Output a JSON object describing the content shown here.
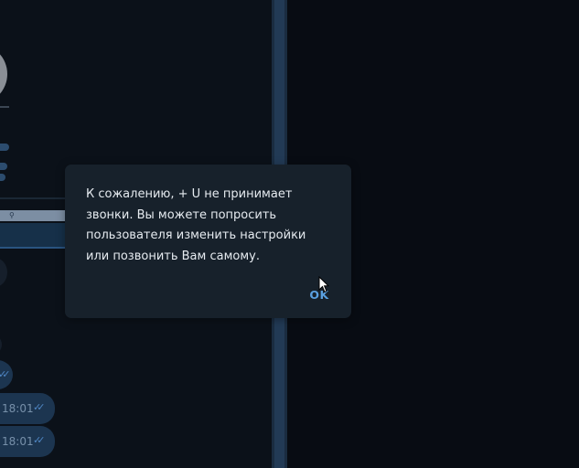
{
  "dialog": {
    "message": "К сожалению, + U не принимает\nзвонки. Вы можете попросить\nпользователя изменить настройки\nили позвонить Вам самому.",
    "ok_label": "OK"
  },
  "chat": {
    "messages": [
      {
        "time": "18:01",
        "status_icon": "double-check-icon"
      },
      {
        "time": "18:01",
        "status_icon": "double-check-icon"
      }
    ]
  },
  "colors": {
    "dialog_background": "#17212b",
    "accent": "#5aa0e0",
    "app_background": "#080c13",
    "bubble_outgoing": "#1c3550"
  }
}
